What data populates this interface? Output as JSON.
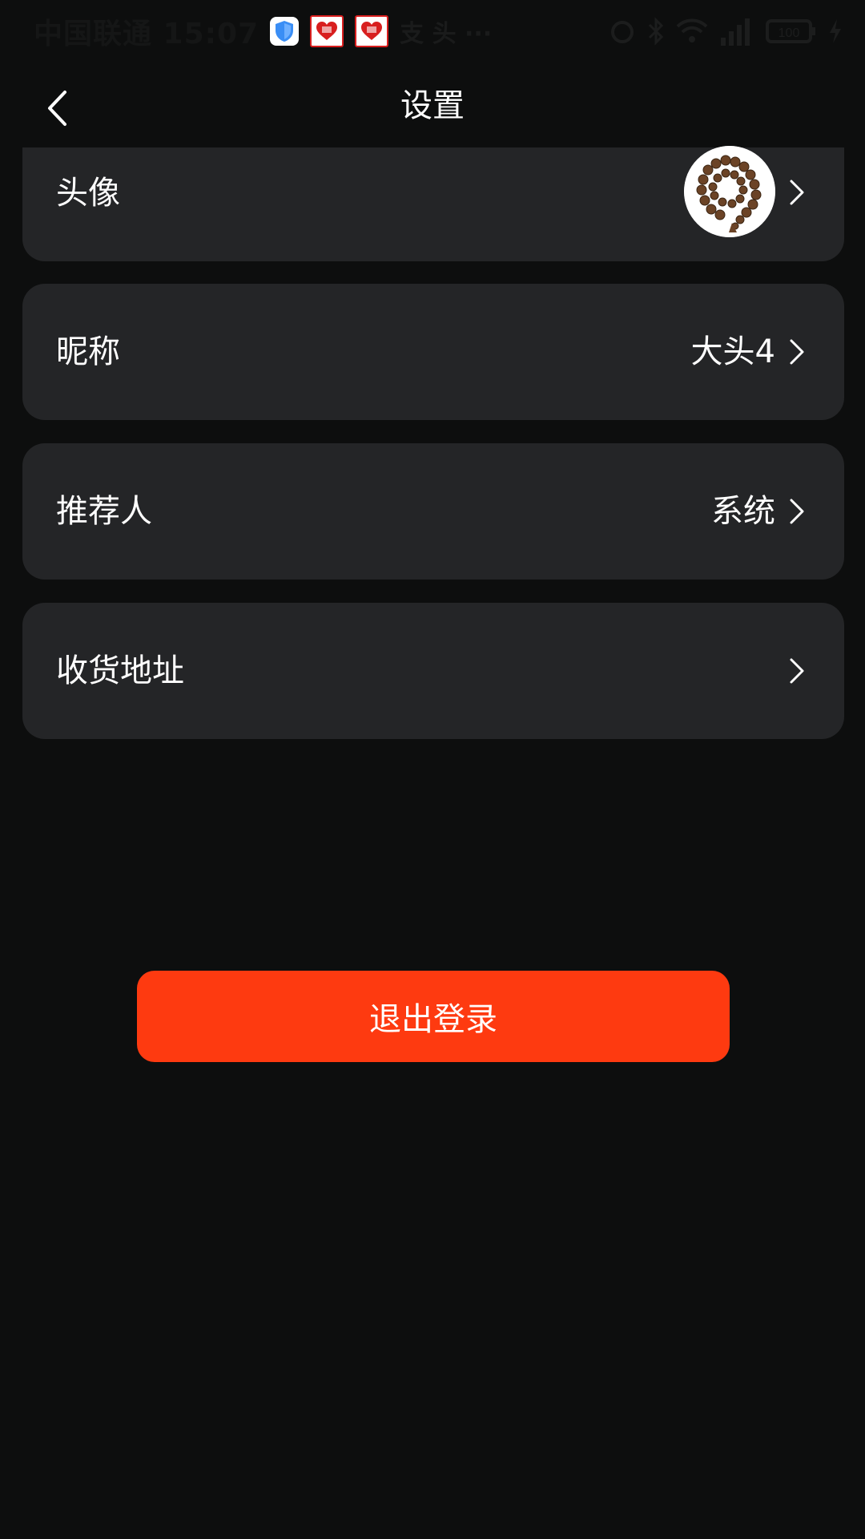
{
  "status_bar": {
    "carrier_time": "中国联通 15:07",
    "notifications": "支 头 ···",
    "battery": "100"
  },
  "header": {
    "title": "设置"
  },
  "settings": {
    "avatar_label": "头像",
    "nickname_label": "昵称",
    "nickname_value": "大头4",
    "referrer_label": "推荐人",
    "referrer_value": "系统",
    "address_label": "收货地址"
  },
  "logout": {
    "label": "退出登录"
  },
  "colors": {
    "background": "#0d0e0e",
    "card": "#242527",
    "accent": "#fe3a10",
    "text": "#ffffff"
  }
}
